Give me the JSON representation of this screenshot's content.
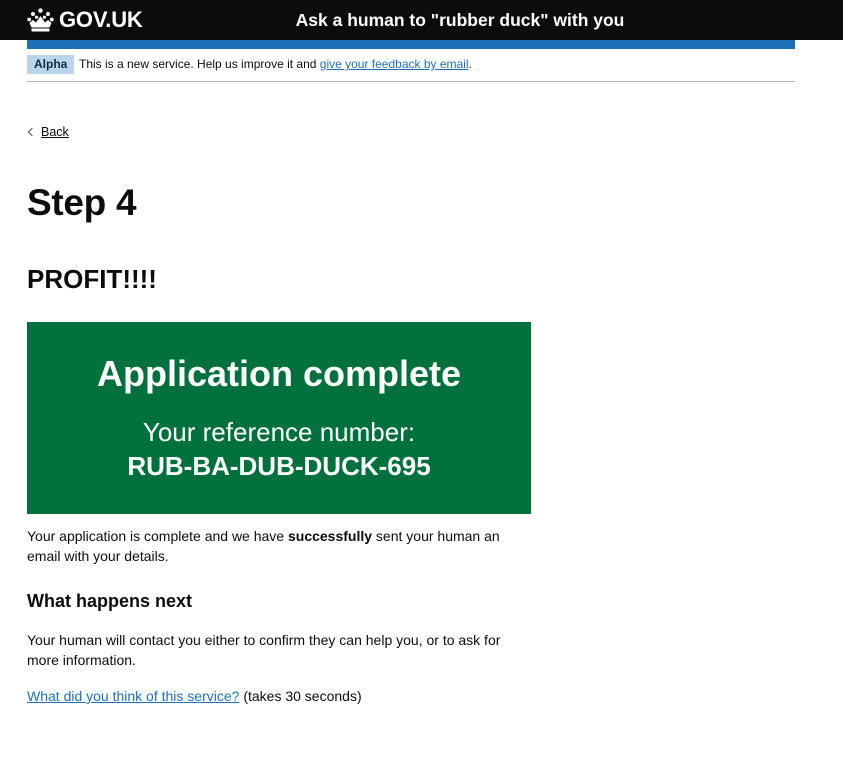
{
  "header": {
    "logo_text": "GOV.UK",
    "logo_icon": "crown-icon",
    "service_name": "Ask a human to \"rubber duck\" with you"
  },
  "phase_banner": {
    "tag": "Alpha",
    "text_before": "This is a new service. Help us improve it and ",
    "link": "give your feedback by email",
    "text_after": "."
  },
  "back_link": {
    "label": "Back",
    "icon": "chevron-left-icon"
  },
  "page": {
    "title": "Step 4",
    "subtitle": "PROFIT!!!!"
  },
  "panel": {
    "title": "Application complete",
    "reference_label": "Your reference number:",
    "reference_number": "RUB-BA-DUB-DUCK-695"
  },
  "confirmation": {
    "text_before": "Your application is complete and we have ",
    "text_bold": "successfully",
    "text_after": " sent your human an email with your details."
  },
  "next_steps": {
    "heading": "What happens next",
    "text": "Your human will contact you either to confirm they can help you, or to ask for more information."
  },
  "feedback": {
    "link": "What did you think of this service?",
    "suffix": " (takes 30 seconds)"
  },
  "colors": {
    "header_bg": "#0b0c0c",
    "brand_blue": "#1d70b8",
    "panel_green": "#00703c",
    "phase_tag_bg": "#bbd4ea"
  }
}
